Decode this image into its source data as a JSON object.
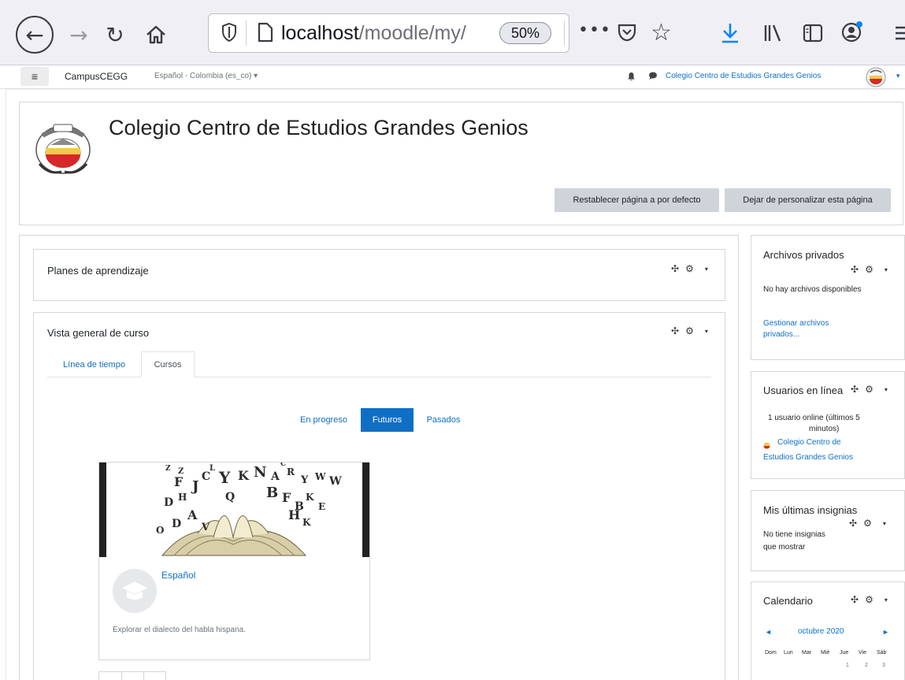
{
  "browser": {
    "url_host": "localhost",
    "url_path": "/moodle/my/",
    "zoom": "50%",
    "more_label": "•••"
  },
  "navbar": {
    "menu_glyph": "≡",
    "site_name": "CampusCEGG",
    "language": "Español - Colombia (es_co) ▾",
    "user_name": "Colegio Centro de Estudios Grandes Genios",
    "user_caret": "▾"
  },
  "header": {
    "title": "Colegio Centro de Estudios Grandes Genios",
    "reset_button": "Restablecer página a por defecto",
    "stop_customise_button": "Dejar de personalizar esta página"
  },
  "blocks": {
    "plans": {
      "title": "Planes de aprendizaje"
    },
    "overview": {
      "title": "Vista general de curso",
      "tabs": [
        {
          "label": "Línea de tiempo",
          "active": false
        },
        {
          "label": "Cursos",
          "active": true
        }
      ],
      "filters": [
        {
          "label": "En progreso",
          "active": false
        },
        {
          "label": "Futuros",
          "active": true
        },
        {
          "label": "Pasados",
          "active": false
        }
      ],
      "course": {
        "name": "Español",
        "summary": "Explorar el dialecto del habla hispana."
      }
    },
    "files": {
      "title": "Archivos privados",
      "empty": "No hay archivos disponibles",
      "manage_link_1": "Gestionar archivos",
      "manage_link_2": "privados..."
    },
    "online": {
      "title": "Usuarios en línea",
      "count_1": "1 usuario online (últimos 5",
      "count_2": "minutos)",
      "user_1": "Colegio Centro de",
      "user_2": "Estudios Grandes Genios"
    },
    "badges": {
      "title": "Mis últimas insignias",
      "empty_1": "No tiene insignias",
      "empty_2": "que mostrar"
    },
    "calendar": {
      "title": "Calendario",
      "prev": "◄",
      "month": "octubre 2020",
      "next": "►",
      "weekdays": [
        "Dom",
        "Lun",
        "Mar",
        "Mié",
        "Jue",
        "Vie",
        "Sáb"
      ],
      "first_row": [
        "1",
        "2",
        "3"
      ]
    }
  },
  "colors": {
    "link": "#0f6fc5",
    "button_gray": "#ced4da",
    "active_filter": "#0f6fc5"
  }
}
